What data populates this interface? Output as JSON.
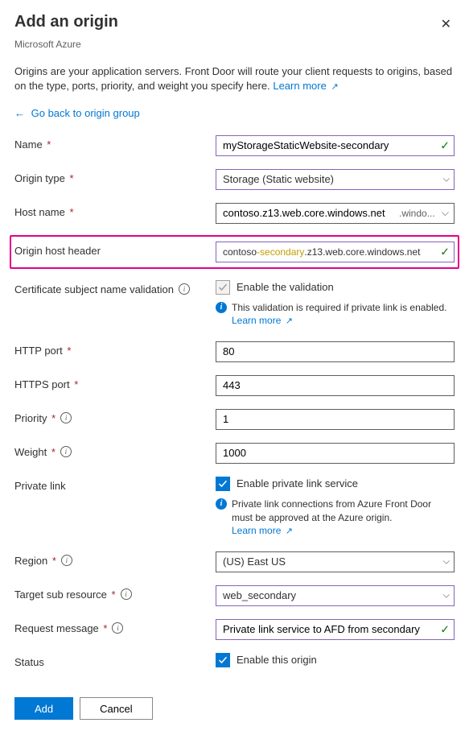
{
  "header": {
    "title": "Add an origin",
    "subtitle": "Microsoft Azure"
  },
  "intro": {
    "text": "Origins are your application servers. Front Door will route your client requests to origins, based on the type, ports, priority, and weight you specify here.",
    "learn_more": "Learn more"
  },
  "back_link": "Go back to origin group",
  "fields": {
    "name": {
      "label": "Name",
      "value": "myStorageStaticWebsite-secondary"
    },
    "origin_type": {
      "label": "Origin type",
      "value": "Storage (Static website)"
    },
    "host_name": {
      "label": "Host name",
      "value": "contoso.z13.web.core.windows.net",
      "dropdown_hint": ".windo..."
    },
    "host_header": {
      "label": "Origin host header",
      "prefix": "contoso",
      "highlight": "-secondary",
      "suffix": ".z13.web.core.windows.net"
    },
    "cert_validation": {
      "label": "Certificate subject name validation",
      "checkbox_label": "Enable the validation",
      "info": "This validation is required if private link is enabled.",
      "learn_more": "Learn more"
    },
    "http_port": {
      "label": "HTTP port",
      "value": "80"
    },
    "https_port": {
      "label": "HTTPS port",
      "value": "443"
    },
    "priority": {
      "label": "Priority",
      "value": "1"
    },
    "weight": {
      "label": "Weight",
      "value": "1000"
    },
    "private_link": {
      "label": "Private link",
      "checkbox_label": "Enable private link service",
      "info": "Private link connections from Azure Front Door must be approved at the Azure origin.",
      "learn_more": "Learn more"
    },
    "region": {
      "label": "Region",
      "value": "(US) East US"
    },
    "target_sub": {
      "label": "Target sub resource",
      "value": "web_secondary"
    },
    "request_message": {
      "label": "Request message",
      "value": "Private link service to AFD from secondary"
    },
    "status": {
      "label": "Status",
      "checkbox_label": "Enable this origin"
    }
  },
  "footer": {
    "add": "Add",
    "cancel": "Cancel"
  }
}
